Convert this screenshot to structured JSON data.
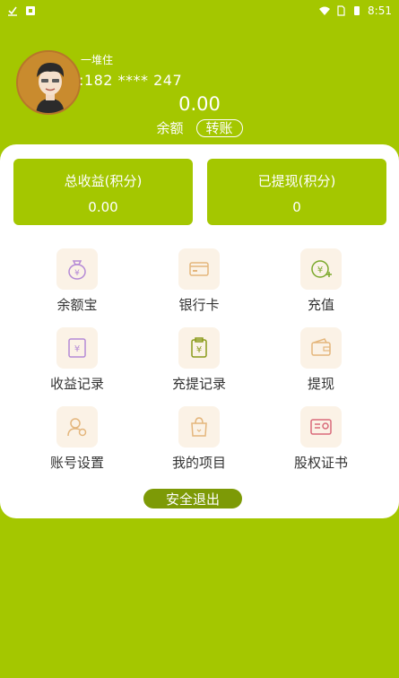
{
  "status_bar": {
    "time": "8:51"
  },
  "profile": {
    "username": "一堆住",
    "phone": ":182 **** 247"
  },
  "balance": {
    "amount": "0.00",
    "label": "余额",
    "transfer_label": "转账"
  },
  "stats": {
    "total_income_label": "总收益(积分)",
    "total_income_value": "0.00",
    "withdrawn_label": "已提现(积分)",
    "withdrawn_value": "0"
  },
  "menu": [
    {
      "label": "余额宝",
      "icon": "money-bag-icon"
    },
    {
      "label": "银行卡",
      "icon": "bank-card-icon"
    },
    {
      "label": "充值",
      "icon": "recharge-icon"
    },
    {
      "label": "收益记录",
      "icon": "income-record-icon"
    },
    {
      "label": "充提记录",
      "icon": "transaction-record-icon"
    },
    {
      "label": "提现",
      "icon": "wallet-icon"
    },
    {
      "label": "账号设置",
      "icon": "account-settings-icon"
    },
    {
      "label": "我的项目",
      "icon": "shopping-bag-icon"
    },
    {
      "label": "股权证书",
      "icon": "certificate-icon"
    }
  ],
  "logout_label": "安全退出",
  "colors": {
    "brand_green": "#a4c700",
    "dark_green": "#7d9a06",
    "icon_bg": "#fbf2e6"
  }
}
